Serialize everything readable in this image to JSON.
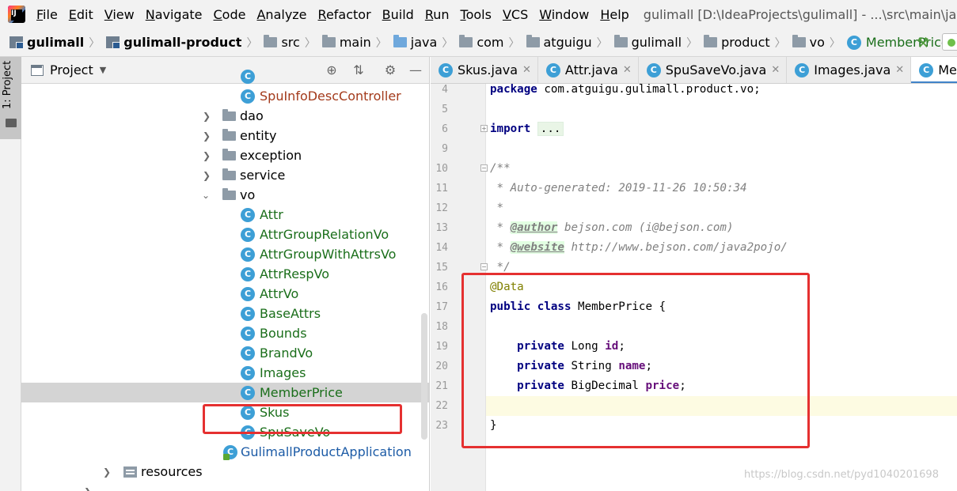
{
  "menu": {
    "items": [
      "File",
      "Edit",
      "View",
      "Navigate",
      "Code",
      "Analyze",
      "Refactor",
      "Build",
      "Run",
      "Tools",
      "VCS",
      "Window",
      "Help"
    ],
    "window_title": "gulimall [D:\\IdeaProjects\\gulimall] - ...\\src\\main\\java\\com\\a"
  },
  "breadcrumbs": [
    "gulimall",
    "gulimall-product",
    "src",
    "main",
    "java",
    "com",
    "atguigu",
    "gulimall",
    "product",
    "vo",
    "MemberPrice"
  ],
  "left_strip": {
    "project_tab": "1: Project"
  },
  "project_panel": {
    "title": "Project",
    "tree": [
      {
        "label": "SpuInfoDescController",
        "kind": "class",
        "color": "red"
      },
      {
        "label": "dao",
        "kind": "folder"
      },
      {
        "label": "entity",
        "kind": "folder"
      },
      {
        "label": "exception",
        "kind": "folder"
      },
      {
        "label": "service",
        "kind": "folder"
      },
      {
        "label": "vo",
        "kind": "folder",
        "expanded": true
      },
      {
        "label": "Attr",
        "kind": "class"
      },
      {
        "label": "AttrGroupRelationVo",
        "kind": "class"
      },
      {
        "label": "AttrGroupWithAttrsVo",
        "kind": "class"
      },
      {
        "label": "AttrRespVo",
        "kind": "class"
      },
      {
        "label": "AttrVo",
        "kind": "class"
      },
      {
        "label": "BaseAttrs",
        "kind": "class"
      },
      {
        "label": "Bounds",
        "kind": "class"
      },
      {
        "label": "BrandVo",
        "kind": "class"
      },
      {
        "label": "Images",
        "kind": "class"
      },
      {
        "label": "MemberPrice",
        "kind": "class",
        "selected": true
      },
      {
        "label": "Skus",
        "kind": "class"
      },
      {
        "label": "SpuSaveVo",
        "kind": "class"
      },
      {
        "label": "GulimallProductApplication",
        "kind": "app"
      },
      {
        "label": "resources",
        "kind": "resources"
      }
    ]
  },
  "editor": {
    "tabs": [
      {
        "label": "Skus.java",
        "active": false
      },
      {
        "label": "Attr.java",
        "active": false
      },
      {
        "label": "SpuSaveVo.java",
        "active": false
      },
      {
        "label": "Images.java",
        "active": false
      },
      {
        "label": "MemberPrice",
        "active": true
      }
    ],
    "line_numbers": [
      "4",
      "5",
      "6",
      "9",
      "10",
      "11",
      "12",
      "13",
      "14",
      "15",
      "16",
      "17",
      "18",
      "19",
      "20",
      "21",
      "22",
      "23"
    ],
    "code": {
      "l4_kw": "package",
      "l4_rest": " com.atguigu.gulimall.product.vo;",
      "l6_kw": "import",
      "l6_fold": "...",
      "l10": "/**",
      "l11": " * Auto-generated: 2019-11-26 10:50:34",
      "l12": " *",
      "l13_pre": " * ",
      "l13_tag": "@author",
      "l13_rest": " bejson.com (i@bejson.com)",
      "l14_pre": " * ",
      "l14_tag": "@website",
      "l14_rest": " http://www.bejson.com/java2pojo/",
      "l15": " */",
      "l16": "@Data",
      "l17_kw1": "public",
      "l17_kw2": "class",
      "l17_rest": " MemberPrice {",
      "l19_kw": "private",
      "l19_type": " Long ",
      "l19_field": "id",
      "l19_end": ";",
      "l20_kw": "private",
      "l20_type": " String ",
      "l20_field": "name",
      "l20_end": ";",
      "l21_kw": "private",
      "l21_type": " BigDecimal ",
      "l21_field": "price",
      "l21_end": ";",
      "l23": "}"
    }
  },
  "watermark": "https://blog.csdn.net/pyd1040201698",
  "colors": {
    "highlight_box": "#e53030",
    "class_icon": "#3d9fd6",
    "keyword": "#000080"
  }
}
